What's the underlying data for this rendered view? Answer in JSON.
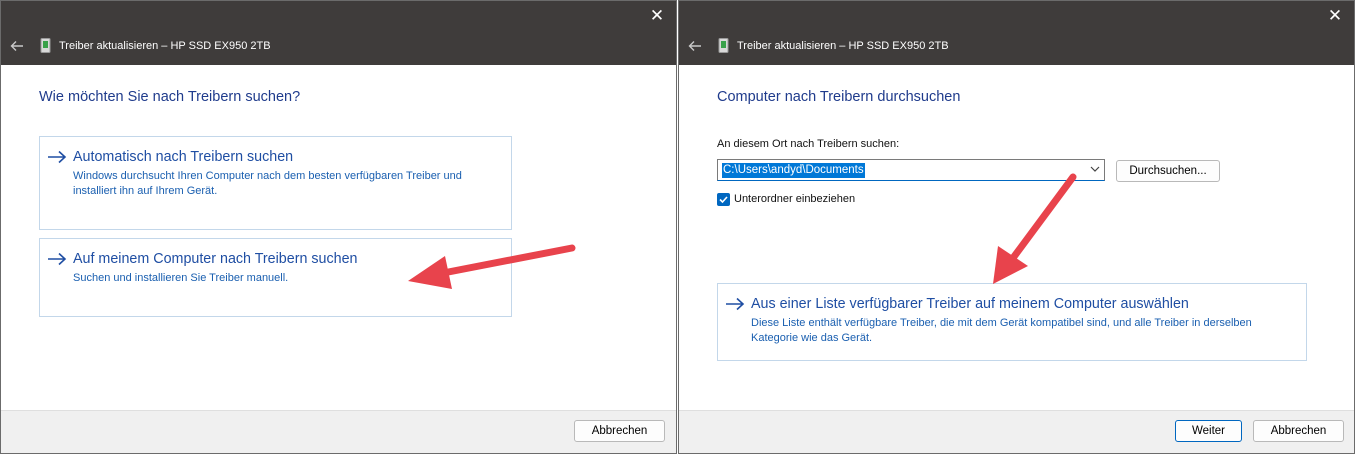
{
  "left": {
    "window_title": "Treiber aktualisieren – HP SSD EX950 2TB",
    "close_glyph": "✕",
    "heading": "Wie möchten Sie nach Treibern suchen?",
    "options": [
      {
        "title": "Automatisch nach Treibern suchen",
        "desc1": "Windows durchsucht Ihren Computer nach dem besten verfügbaren Treiber und",
        "desc2": "installiert ihn auf Ihrem Gerät."
      },
      {
        "title": "Auf meinem Computer nach Treibern suchen",
        "desc1": "Suchen und installieren Sie Treiber manuell.",
        "desc2": ""
      }
    ],
    "cancel_label": "Abbrechen"
  },
  "right": {
    "window_title": "Treiber aktualisieren – HP SSD EX950 2TB",
    "close_glyph": "✕",
    "heading": "Computer nach Treibern durchsuchen",
    "search_label": "An diesem Ort nach Treibern suchen:",
    "path_value": "C:\\Users\\andyd\\Documents",
    "browse_label": "Durchsuchen...",
    "subfolders_label": "Unterordner einbeziehen",
    "subfolders_checked": true,
    "option": {
      "title": "Aus einer Liste verfügbarer Treiber auf meinem Computer auswählen",
      "desc1": "Diese Liste enthält verfügbare Treiber, die mit dem Gerät kompatibel sind, und alle Treiber in derselben",
      "desc2": "Kategorie wie das Gerät."
    },
    "next_label": "Weiter",
    "cancel_label": "Abbrechen"
  },
  "colors": {
    "titlebar": "#3f3c3b",
    "heading": "#1f3b8c",
    "link": "#1f4ea3",
    "annotation_arrow": "#e8434c"
  },
  "icons": [
    "back-arrow-icon",
    "drive-icon",
    "close-icon",
    "right-arrow-icon",
    "chevron-down-icon",
    "checkmark-icon"
  ]
}
